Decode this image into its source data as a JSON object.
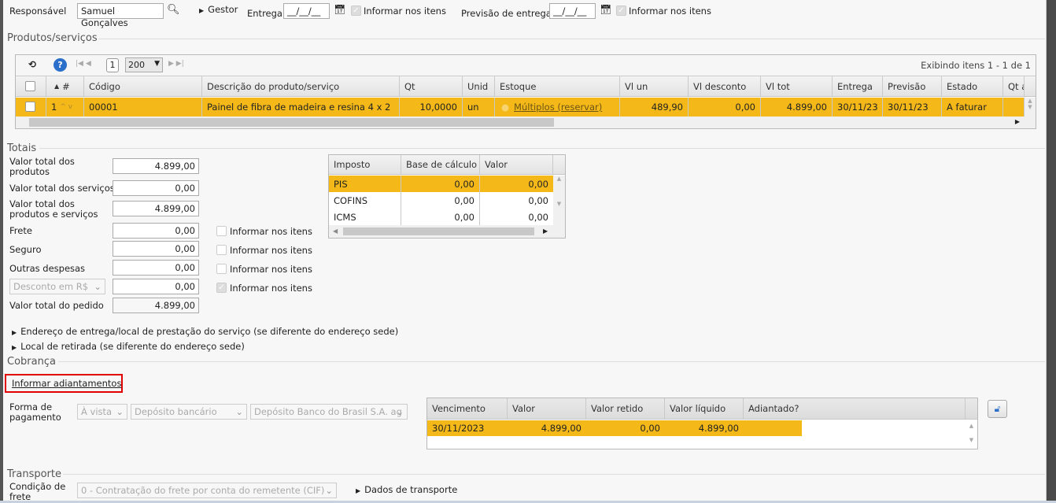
{
  "header": {
    "responsavel_label": "Responsável",
    "responsavel_value": "Samuel Gonçalves",
    "gestor_label": "Gestor",
    "entrega_label": "Entrega",
    "entrega_value": "__/__/__",
    "informar1": "Informar nos itens",
    "previsao_label": "Previsão de entrega",
    "previsao_value": "__/__/__",
    "informar2": "Informar nos itens"
  },
  "produtos": {
    "title": "Produtos/serviços",
    "page": "1",
    "page_size": "200",
    "exibindo": "Exibindo itens 1 - 1 de 1",
    "columns": [
      "#",
      "Código",
      "Descrição do produto/serviço",
      "Qt",
      "Unid",
      "Estoque",
      "Vl un",
      "Vl desconto",
      "Vl tot",
      "Entrega",
      "Previsão",
      "Estado",
      "Qt a"
    ],
    "rows": [
      {
        "num": "1",
        "codigo": "00001",
        "descricao": "Painel de fibra de madeira e resina 4 x 2",
        "qt": "10,0000",
        "unid": "un",
        "estoque": "Múltiplos (reservar)",
        "vl_un": "489,90",
        "vl_desconto": "0,00",
        "vl_tot": "4.899,00",
        "entrega": "30/11/23",
        "previsao": "30/11/23",
        "estado": "A faturar"
      }
    ]
  },
  "totais": {
    "title": "Totais",
    "fields": [
      {
        "label": "Valor total dos produtos",
        "value": "4.899,00"
      },
      {
        "label": "Valor total dos serviços",
        "value": "0,00"
      },
      {
        "label": "Valor total dos produtos e serviços",
        "value": "4.899,00"
      },
      {
        "label": "Frete",
        "value": "0,00"
      },
      {
        "label": "Seguro",
        "value": "0,00"
      },
      {
        "label": "Outras despesas",
        "value": "0,00"
      },
      {
        "label": "Desconto em R$",
        "value": "0,00"
      },
      {
        "label": "Valor total do pedido",
        "value": "4.899,00"
      }
    ],
    "informar": "Informar nos itens",
    "impostos": {
      "columns": [
        "Imposto",
        "Base de cálculo",
        "Valor"
      ],
      "rows": [
        [
          "PIS",
          "0,00",
          "0,00"
        ],
        [
          "COFINS",
          "0,00",
          "0,00"
        ],
        [
          "ICMS",
          "0,00",
          "0,00"
        ]
      ]
    }
  },
  "links": {
    "endereco": "Endereço de entrega/local de prestação do serviço (se diferente do endereço sede)",
    "retirada": "Local de retirada (se diferente do endereço sede)"
  },
  "cobranca": {
    "title": "Cobrança",
    "adiantamentos": "Informar adiantamentos",
    "forma_label": "Forma de pagamento",
    "forma1": "À vista",
    "forma2": "Depósito bancário",
    "forma3": "Depósito Banco do Brasil S.A. ag",
    "columns": [
      "Vencimento",
      "Valor",
      "Valor retido",
      "Valor líquido",
      "Adiantado?"
    ],
    "rows": [
      [
        "30/11/2023",
        "4.899,00",
        "0,00",
        "4.899,00",
        ""
      ]
    ]
  },
  "transporte": {
    "title": "Transporte",
    "condicao_label": "Condição de frete",
    "condicao_value": "0 - Contratação do frete por conta do remetente (CIF)",
    "dados": "Dados de transporte"
  },
  "colors": {
    "selected_row": "#f4b918",
    "highlight_border": "#e00000"
  }
}
